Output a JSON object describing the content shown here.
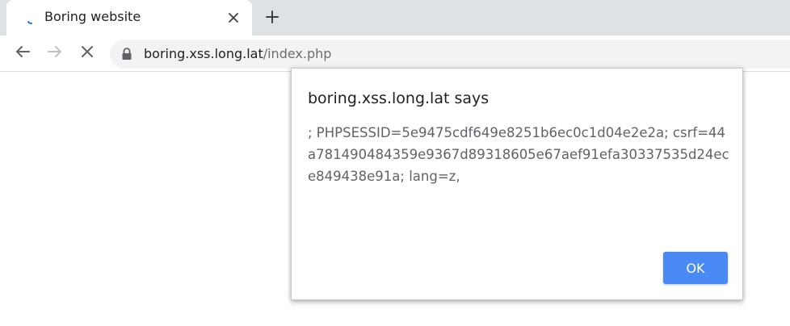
{
  "tab": {
    "title": "Boring website",
    "close_icon": "close-icon",
    "favicon": "loading-spinner-icon"
  },
  "new_tab_icon": "plus-icon",
  "toolbar": {
    "back_icon": "back-arrow-icon",
    "forward_icon": "forward-arrow-icon",
    "stop_icon": "stop-icon",
    "lock_icon": "lock-icon",
    "url_host": "boring.xss.long.lat",
    "url_path": "/index.php"
  },
  "dialog": {
    "title": "boring.xss.long.lat says",
    "message": "; PHPSESSID=5e9475cdf649e8251b6ec0c1d04e2e2a; csrf=44a781490484359e9367d89318605e67aef91efa30337535d24ece849438e91a; lang=z,",
    "ok_label": "OK"
  },
  "colors": {
    "accent": "#4a8af4",
    "tabstrip_bg": "#dee1e6",
    "omnibox_bg": "#f1f3f4"
  }
}
